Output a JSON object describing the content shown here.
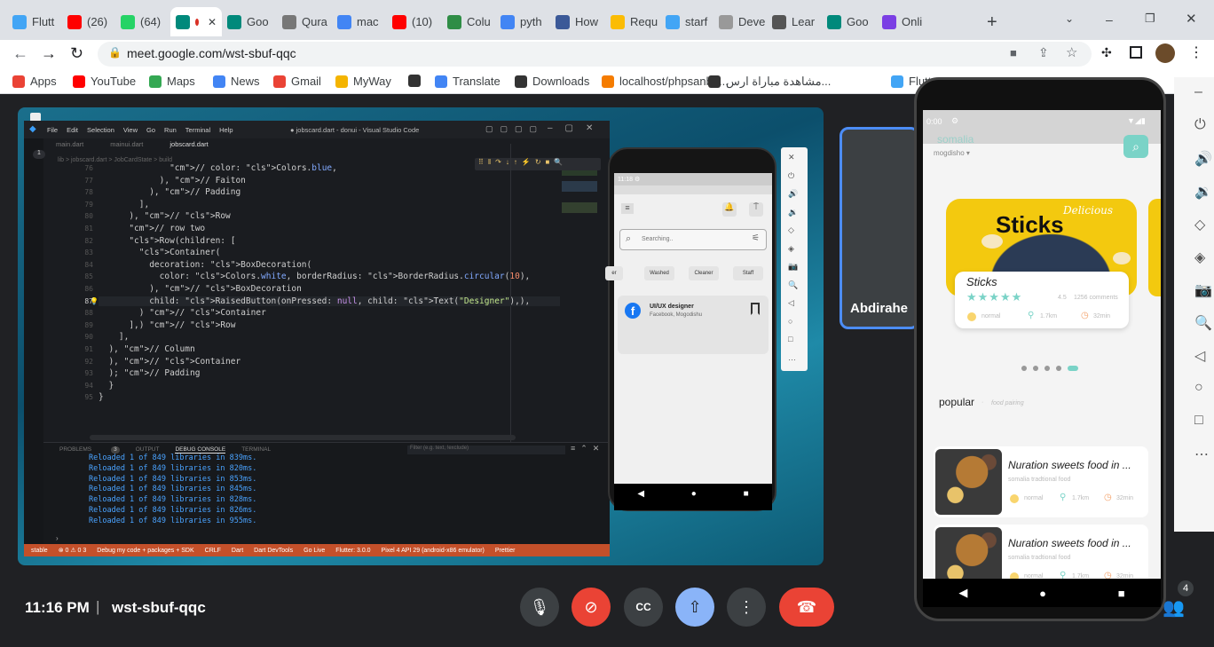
{
  "browser": {
    "tabs": [
      {
        "label": "Flutt",
        "icon": "flutter-icon",
        "color": "#42a5f5"
      },
      {
        "label": "(26)",
        "icon": "youtube-icon",
        "color": "#ff0000"
      },
      {
        "label": "(64)",
        "icon": "whatsapp-icon",
        "color": "#25d366"
      },
      {
        "label": "",
        "icon": "meet-icon",
        "color": "#00897b",
        "active": true
      },
      {
        "label": "Goo",
        "icon": "meet-icon",
        "color": "#00897b"
      },
      {
        "label": "Qura",
        "icon": "quran-icon",
        "color": "#777"
      },
      {
        "label": "mac",
        "icon": "google-icon",
        "color": "#4285f4"
      },
      {
        "label": "(10)",
        "icon": "youtube-icon",
        "color": "#ff0000"
      },
      {
        "label": "Colu",
        "icon": "geeks-icon",
        "color": "#2f8d46"
      },
      {
        "label": "pyth",
        "icon": "google-icon",
        "color": "#4285f4"
      },
      {
        "label": "How",
        "icon": "stack-icon",
        "color": "#3b5998"
      },
      {
        "label": "Requ",
        "icon": "drive-icon",
        "color": "#fbbc04"
      },
      {
        "label": "starf",
        "icon": "flutter-icon",
        "color": "#42a5f5"
      },
      {
        "label": "Deve",
        "icon": "doc-icon",
        "color": "#999"
      },
      {
        "label": "Lear",
        "icon": "glasses-icon",
        "color": "#555"
      },
      {
        "label": "Goo",
        "icon": "meet-icon",
        "color": "#00897b"
      },
      {
        "label": "Onli",
        "icon": "purple-icon",
        "color": "#7b3fe4"
      }
    ],
    "url": "meet.google.com/wst-sbuf-qqc",
    "bookmarks": [
      {
        "label": "Apps",
        "color": "#ea4335"
      },
      {
        "label": "YouTube",
        "color": "#ff0000"
      },
      {
        "label": "Maps",
        "color": "#34a853"
      },
      {
        "label": "News",
        "color": "#4285f4"
      },
      {
        "label": "Gmail",
        "color": "#ea4335"
      },
      {
        "label": "MyWay",
        "color": "#f4b400"
      },
      {
        "label": "",
        "color": "#333"
      },
      {
        "label": "Translate",
        "color": "#4285f4"
      },
      {
        "label": "Downloads",
        "color": "#333"
      },
      {
        "label": "localhost/phpsanbo...",
        "color": "#f57c00"
      },
      {
        "label": "مشاهدة مباراة ارس...",
        "color": "#333"
      },
      {
        "label": "Flutter A...",
        "color": "#42a5f5"
      }
    ]
  },
  "vscode": {
    "menu": [
      "File",
      "Edit",
      "Selection",
      "View",
      "Go",
      "Run",
      "Terminal",
      "Help"
    ],
    "title": "● jobscard.dart - donui - Visual Studio Code",
    "tabs": [
      "main.dart",
      "mainui.dart",
      "jobscard.dart"
    ],
    "breadcrumb": "lib > jobscard.dart > JobCardState > build",
    "line_numbers": [
      "76",
      "77",
      "78",
      "79",
      "80",
      "81",
      "82",
      "83",
      "84",
      "85",
      "86",
      "87",
      "88",
      "89",
      "90",
      "91",
      "92",
      "93",
      "94",
      "95",
      "96"
    ],
    "code": [
      "              // color: Colors.blue,",
      "            ), // Faiton",
      "          ), // Padding",
      "        ],",
      "      ), // Row",
      "      // row two",
      "      Row(children: [",
      "        Container(",
      "          decoration: BoxDecoration(",
      "            color: Colors.white, borderRadius: BorderRadius.circular(10),",
      "          ), // BoxDecoration",
      "          child: RaisedButton(onPressed: null, child: Text(\"Designer\"),),",
      "        ) // Container",
      "      ],) // Row",
      "    ],",
      "  ), // Column",
      "  ), // Container",
      "  ); // Padding",
      "  }",
      "}"
    ],
    "panel_tabs": [
      "PROBLEMS",
      "OUTPUT",
      "DEBUG CONSOLE",
      "TERMINAL"
    ],
    "problems_count": "3",
    "filter_placeholder": "Filter (e.g. text, !exclude)",
    "console": [
      "Reloaded 1 of 849 libraries in 839ms.",
      "Reloaded 1 of 849 libraries in 820ms.",
      "Reloaded 1 of 849 libraries in 853ms.",
      "Reloaded 1 of 849 libraries in 845ms.",
      "Reloaded 1 of 849 libraries in 828ms.",
      "Reloaded 1 of 849 libraries in 826ms.",
      "Reloaded 1 of 849 libraries in 955ms."
    ],
    "status": [
      "stable",
      "⊗ 0 ⚠ 0 3",
      "Debug my code + packages + SDK",
      "CRLF",
      "Dart",
      "Dart DevTools",
      "Go Live",
      "Flutter: 3.0.0",
      "Pixel 4 API 29 (android-x86 emulator)",
      "Prettier"
    ]
  },
  "small_app": {
    "time": "11:18",
    "search_placeholder": "Searching..",
    "chips": [
      "er",
      "Washed",
      "Cleaner",
      "Staff"
    ],
    "job_title": "UI/UX designer",
    "job_subtitle": "Facebook, Mogodishu"
  },
  "tile": {
    "name": "Abdirahe"
  },
  "food_app": {
    "time": "0:00",
    "brand": "somalia",
    "location": "mogdisho",
    "banner_script": "Delicious",
    "banner_title": "Sticks",
    "card_title": "Sticks",
    "rating": "4.5",
    "comments": "1256 comments",
    "meta": [
      "normal",
      "1.7km",
      "32min"
    ],
    "section_title": "popular",
    "section_sub": "food pairing",
    "items": [
      {
        "title": "Nuration sweets food in ...",
        "subtitle": "somalia tradtional food",
        "meta": [
          "normal",
          "1.7km",
          "32min"
        ]
      },
      {
        "title": "Nuration sweets food in ...",
        "subtitle": "somalia tradtional food",
        "meta": [
          "normal",
          "1.7km",
          "32min"
        ]
      }
    ]
  },
  "meeting": {
    "time": "11:16 PM",
    "separator": "|",
    "code": "wst-sbuf-qqc",
    "participants": "4"
  },
  "colors": {
    "accent": "#4c8df6",
    "end_call": "#ea4335",
    "share_active": "#8ab4f8",
    "teal": "#7ad3c7"
  }
}
